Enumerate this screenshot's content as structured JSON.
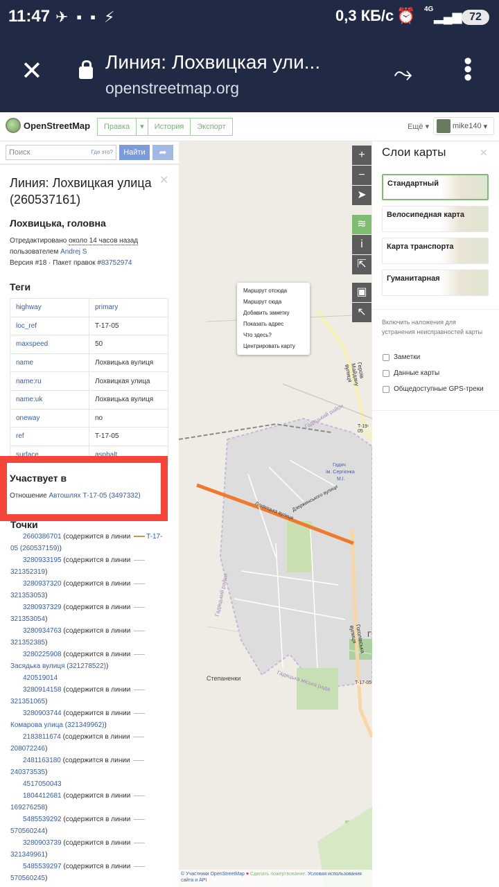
{
  "status": {
    "time": "11:47",
    "speed": "0,3 КБ/с",
    "network": "4G",
    "battery": "72"
  },
  "browser": {
    "title": "Линия: Лохвицкая ули...",
    "url": "openstreetmap.org"
  },
  "nav": {
    "logo": "OpenStreetMap",
    "edit": "Правка",
    "history": "История",
    "export": "Экспорт",
    "more": "Ещё",
    "user": "mike140"
  },
  "search": {
    "placeholder": "Поиск",
    "where": "Где это?",
    "go": "Найти"
  },
  "way": {
    "title": "Линия: Лохвицкая улица (260537161)",
    "name": "Лохвицька, головна",
    "edited_prefix": "Отредактировано ",
    "edited_time": "около 14 часов назад",
    "user_prefix": "пользователем ",
    "user": "Andrej S",
    "version_prefix": "Версия #18 · Пакет правок #",
    "changeset": "83752974"
  },
  "tags": {
    "heading": "Теги",
    "rows": [
      {
        "k": "highway",
        "v": "primary"
      },
      {
        "k": "loc_ref",
        "v": "T-17-05"
      },
      {
        "k": "maxspeed",
        "v": "50"
      },
      {
        "k": "name",
        "v": "Лохвицька вулиця"
      },
      {
        "k": "name:ru",
        "v": "Лохвицкая улица"
      },
      {
        "k": "name:uk",
        "v": "Лохвицька вулиця"
      },
      {
        "k": "oneway",
        "v": "no"
      },
      {
        "k": "ref",
        "v": "T-17-05"
      },
      {
        "k": "surface",
        "v": "asphalt"
      }
    ]
  },
  "relations": {
    "heading": "Участвует в",
    "prefix": "Отношение ",
    "link": "Автошлях Т-17-05 (3497332)"
  },
  "nodes": {
    "heading": "Точки",
    "items": [
      {
        "id": "2660386701",
        "text": " (содержится в линии ",
        "link": "T-17-05 (260537159)",
        "end": ")"
      },
      {
        "id": "3280933195",
        "text": " (содержится в линии ",
        "link": "321352319",
        "end": ")"
      },
      {
        "id": "3280937320",
        "text": " (содержится в линии ",
        "link": "321353053",
        "end": ")"
      },
      {
        "id": "3280937329",
        "text": " (содержится в линии ",
        "link": "321353054",
        "end": ")"
      },
      {
        "id": "3280934763",
        "text": " (содержится в линии ",
        "link": "321352385",
        "end": ")"
      },
      {
        "id": "3280225908",
        "text": " (содержится в линии ",
        "link": "Засядька вулиця (321278522)",
        "end": ")"
      },
      {
        "id": "420519014",
        "text": "",
        "link": "",
        "end": ""
      },
      {
        "id": "3280914158",
        "text": " (содержится в линии ",
        "link": "321351065",
        "end": ")"
      },
      {
        "id": "3280903744",
        "text": " (содержится в линии ",
        "link": "Комарова улица (321349962)",
        "end": ")"
      },
      {
        "id": "2183811674",
        "text": " (содержится в линии ",
        "link": "208072246",
        "end": ")"
      },
      {
        "id": "2481163180",
        "text": " (содержится в линии ",
        "link": "240373535",
        "end": ")"
      },
      {
        "id": "4517050043",
        "text": "",
        "link": "",
        "end": ""
      },
      {
        "id": "1804412681",
        "text": " (содержится в линии ",
        "link": "169276258",
        "end": ")"
      },
      {
        "id": "5485539292",
        "text": " (содержится в линии ",
        "link": "570560244",
        "end": ")"
      },
      {
        "id": "3280903739",
        "text": " (содержится в линии ",
        "link": "321349961",
        "end": ")"
      },
      {
        "id": "5485539297",
        "text": " (содержится в линии ",
        "link": "570560245",
        "end": ")"
      }
    ]
  },
  "context_menu": [
    "Маршрут отсюда",
    "Маршрут сюда",
    "Добавить заметку",
    "Показать адрес",
    "Что здесь?",
    "Центрировать карту"
  ],
  "map_labels": {
    "district1": "Гадяцький район",
    "street1": "Героїв Майдану вулиця",
    "road1": "T-19-05",
    "place1": "Гадяч",
    "place2": "ім. Сергієнка",
    "place3": "М.І.",
    "street2": "Дзержинського вулиця",
    "street3": "Лохвицька вулиця",
    "district2": "Гадяцький район",
    "street4": "Гоголівська вулиця",
    "village": "Степаненки",
    "rada": "Гадяцька міська рада",
    "road2": "T-17-05",
    "g": "Г"
  },
  "attribution": {
    "a": "© Участники OpenStreetMap",
    "b": "Сделать пожертвование.",
    "c": "Условия использования сайта и API"
  },
  "layers": {
    "title": "Слои карты",
    "items": [
      "Стандартный",
      "Велосипедная карта",
      "Карта транспорта",
      "Гуманитарная"
    ],
    "hint": "Включить наложения для устранения неисправностей карты",
    "overlays": [
      "Заметки",
      "Данные карты",
      "Общедоступные GPS-треки"
    ]
  },
  "colors": {
    "header": "#212a45",
    "highlight": "#f5443a",
    "way": "#ef7a2d",
    "link": "#355cb1",
    "osm_green": "#7ebc6f"
  }
}
